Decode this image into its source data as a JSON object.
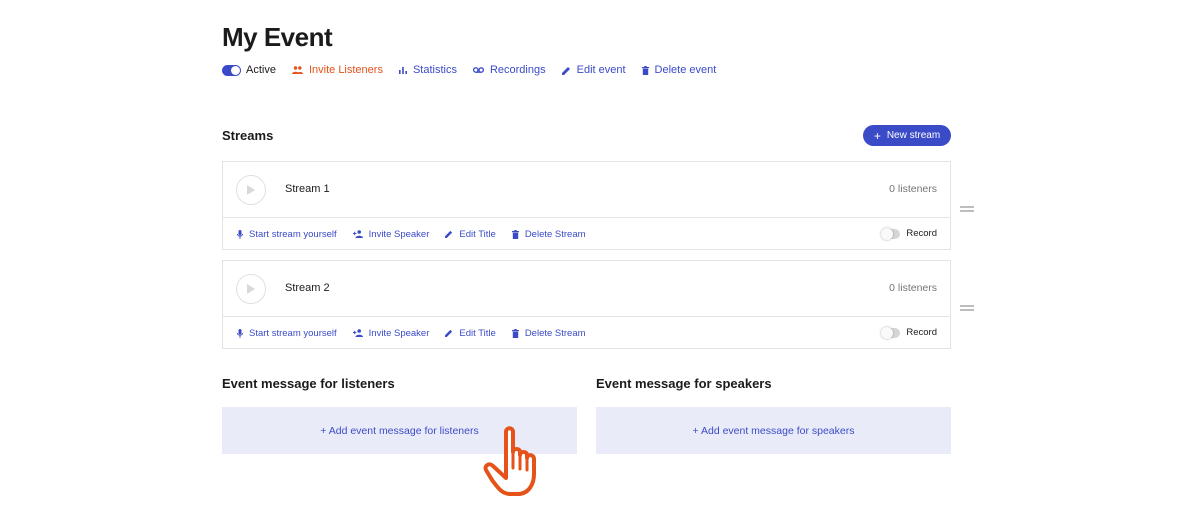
{
  "event": {
    "title": "My Event",
    "status_label": "Active",
    "actions": {
      "invite_listeners": "Invite Listeners",
      "statistics": "Statistics",
      "recordings": "Recordings",
      "edit_event": "Edit event",
      "delete_event": "Delete event"
    }
  },
  "streams_section": {
    "heading": "Streams",
    "new_stream_label": "New stream"
  },
  "streams": [
    {
      "name": "Stream 1",
      "listeners": "0 listeners",
      "start_label": "Start stream yourself",
      "invite_label": "Invite Speaker",
      "edit_label": "Edit Title",
      "delete_label": "Delete Stream",
      "record_label": "Record"
    },
    {
      "name": "Stream 2",
      "listeners": "0 listeners",
      "start_label": "Start stream yourself",
      "invite_label": "Invite Speaker",
      "edit_label": "Edit Title",
      "delete_label": "Delete Stream",
      "record_label": "Record"
    }
  ],
  "messages": {
    "listeners_heading": "Event message for listeners",
    "listeners_add": "+ Add event message for listeners",
    "speakers_heading": "Event message for speakers",
    "speakers_add": "+ Add event message for speakers"
  },
  "colors": {
    "accent": "#3b4bc8",
    "invite": "#e5531a",
    "message_bg": "#e9ecf8",
    "cursor": "#e5531a"
  },
  "icons": {
    "status": "toggle-on-icon",
    "invite_listeners": "people-icon",
    "statistics": "bar-chart-icon",
    "recordings": "voicemail-icon",
    "edit": "pencil-icon",
    "delete": "trash-icon",
    "new_stream": "plus-icon",
    "play": "play-icon",
    "start_stream": "microphone-icon",
    "invite_speaker": "add-person-icon",
    "drag": "drag-handle-icon",
    "cursor": "hand-pointer-icon"
  }
}
